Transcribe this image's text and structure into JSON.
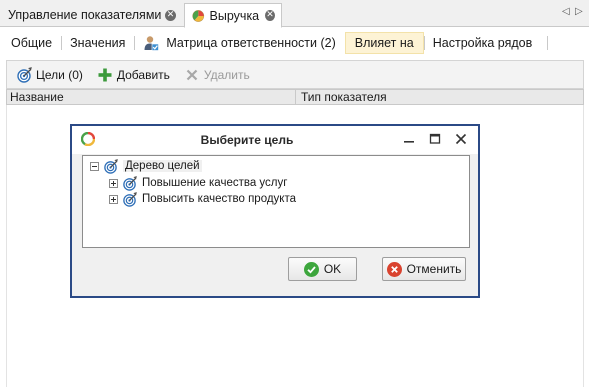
{
  "tabs": [
    {
      "label": "Управление показателями",
      "active": false
    },
    {
      "label": "Выручка",
      "active": true
    }
  ],
  "tab_nav": {
    "prev": "◁",
    "next": "▷"
  },
  "section_tabs": [
    {
      "label": "Общие"
    },
    {
      "label": "Значения"
    },
    {
      "label": "Матрица ответственности (2)"
    },
    {
      "label": "Влияет на",
      "selected": true
    },
    {
      "label": "Настройка рядов"
    }
  ],
  "toolbar": {
    "goals_label": "Цели (0)",
    "add_label": "Добавить",
    "delete_label": "Удалить"
  },
  "grid": {
    "columns": [
      "Название",
      "Тип показателя"
    ]
  },
  "dialog": {
    "title": "Выберите цель",
    "tree": {
      "root": "Дерево целей",
      "children": [
        "Повышение качества услуг",
        "Повысить качество продукта"
      ]
    },
    "ok_label": "OK",
    "cancel_label": "Отменить"
  },
  "colors": {
    "selected_section_bg": "#fdf3d5",
    "dialog_border": "#2b4a86",
    "ok_icon": "#3da63d",
    "cancel_icon": "#d9432f",
    "add_icon": "#3c9a3c"
  },
  "icons": [
    "chart-icon",
    "close-icon",
    "matrix-icon",
    "target-icon",
    "plus-icon",
    "x-icon",
    "app-logo-icon",
    "minimize-icon",
    "maximize-icon",
    "check-icon"
  ]
}
